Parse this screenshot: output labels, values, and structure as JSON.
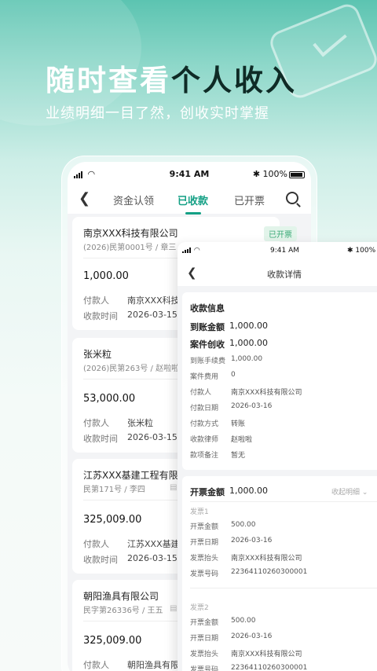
{
  "hero": {
    "title_white": "随时查看",
    "title_dark": "个人收入",
    "subtitle": "业绩明细一目了然，创收实时掌握"
  },
  "status": {
    "time": "9:41 AM",
    "battery": "100%"
  },
  "nav": {
    "tabs": [
      "资金认领",
      "已收款",
      "已开票"
    ],
    "active": "已收款"
  },
  "labels": {
    "payer": "付款人",
    "time": "收款时间"
  },
  "cards": [
    {
      "company": "南京XXX科技有限公司",
      "case": "(2026)民第0001号 / 章三",
      "badge": "已开票",
      "amount": "1,000.00",
      "payer": "南京XXX科技有",
      "time": "2026-03-15"
    },
    {
      "company": "张米粒",
      "case": "(2026)民第263号 /  赵啦啦",
      "amount": "53,000.00",
      "payer": "张米粒",
      "time": "2026-03-15"
    },
    {
      "company": "江苏XXX基建工程有限公",
      "case": "民第171号 / 李四",
      "amount": "325,009.00",
      "payer": "江苏XXX基建工",
      "time": "2026-03-15"
    },
    {
      "company": "朝阳渔具有限公司",
      "case": "民字第26336号 / 王五",
      "amount": "325,009.00",
      "payer": "朝阳渔具有限公"
    }
  ],
  "detail": {
    "time": "9:41 AM",
    "battery": "100%",
    "title": "收款详情",
    "info_heading": "收款信息",
    "received_label": "到账金额",
    "received_value": "1,000.00",
    "case_label": "案件创收",
    "case_value": "1,000.00",
    "rows": [
      {
        "label": "到账手续费",
        "value": "1,000.00"
      },
      {
        "label": "案件费用",
        "value": "0"
      },
      {
        "label": "付款人",
        "value": "南京XXX科技有限公司"
      },
      {
        "label": "付款日期",
        "value": "2026-03-16"
      },
      {
        "label": "付款方式",
        "value": "转账"
      },
      {
        "label": "收款律师",
        "value": "赵啦啦"
      },
      {
        "label": "款项备注",
        "value": "暂无"
      }
    ],
    "invoice_label": "开票金额",
    "invoice_value": "1,000.00",
    "collapse": "收起明细",
    "invoices": [
      {
        "title": "发票1",
        "rows": [
          {
            "label": "开票金额",
            "value": "500.00"
          },
          {
            "label": "开票日期",
            "value": "2026-03-16"
          },
          {
            "label": "发票抬头",
            "value": "南京XXX科技有限公司"
          },
          {
            "label": "发票号码",
            "value": "22364110260300001"
          }
        ]
      },
      {
        "title": "发票2",
        "rows": [
          {
            "label": "开票金额",
            "value": "500.00"
          },
          {
            "label": "开票日期",
            "value": "2026-03-16"
          },
          {
            "label": "发票抬头",
            "value": "南京XXX科技有限公司"
          },
          {
            "label": "发票号码",
            "value": "22364110260300001"
          }
        ]
      }
    ]
  },
  "colors": {
    "accent": "#14a085",
    "hero_bg": "#5cc4b1"
  }
}
